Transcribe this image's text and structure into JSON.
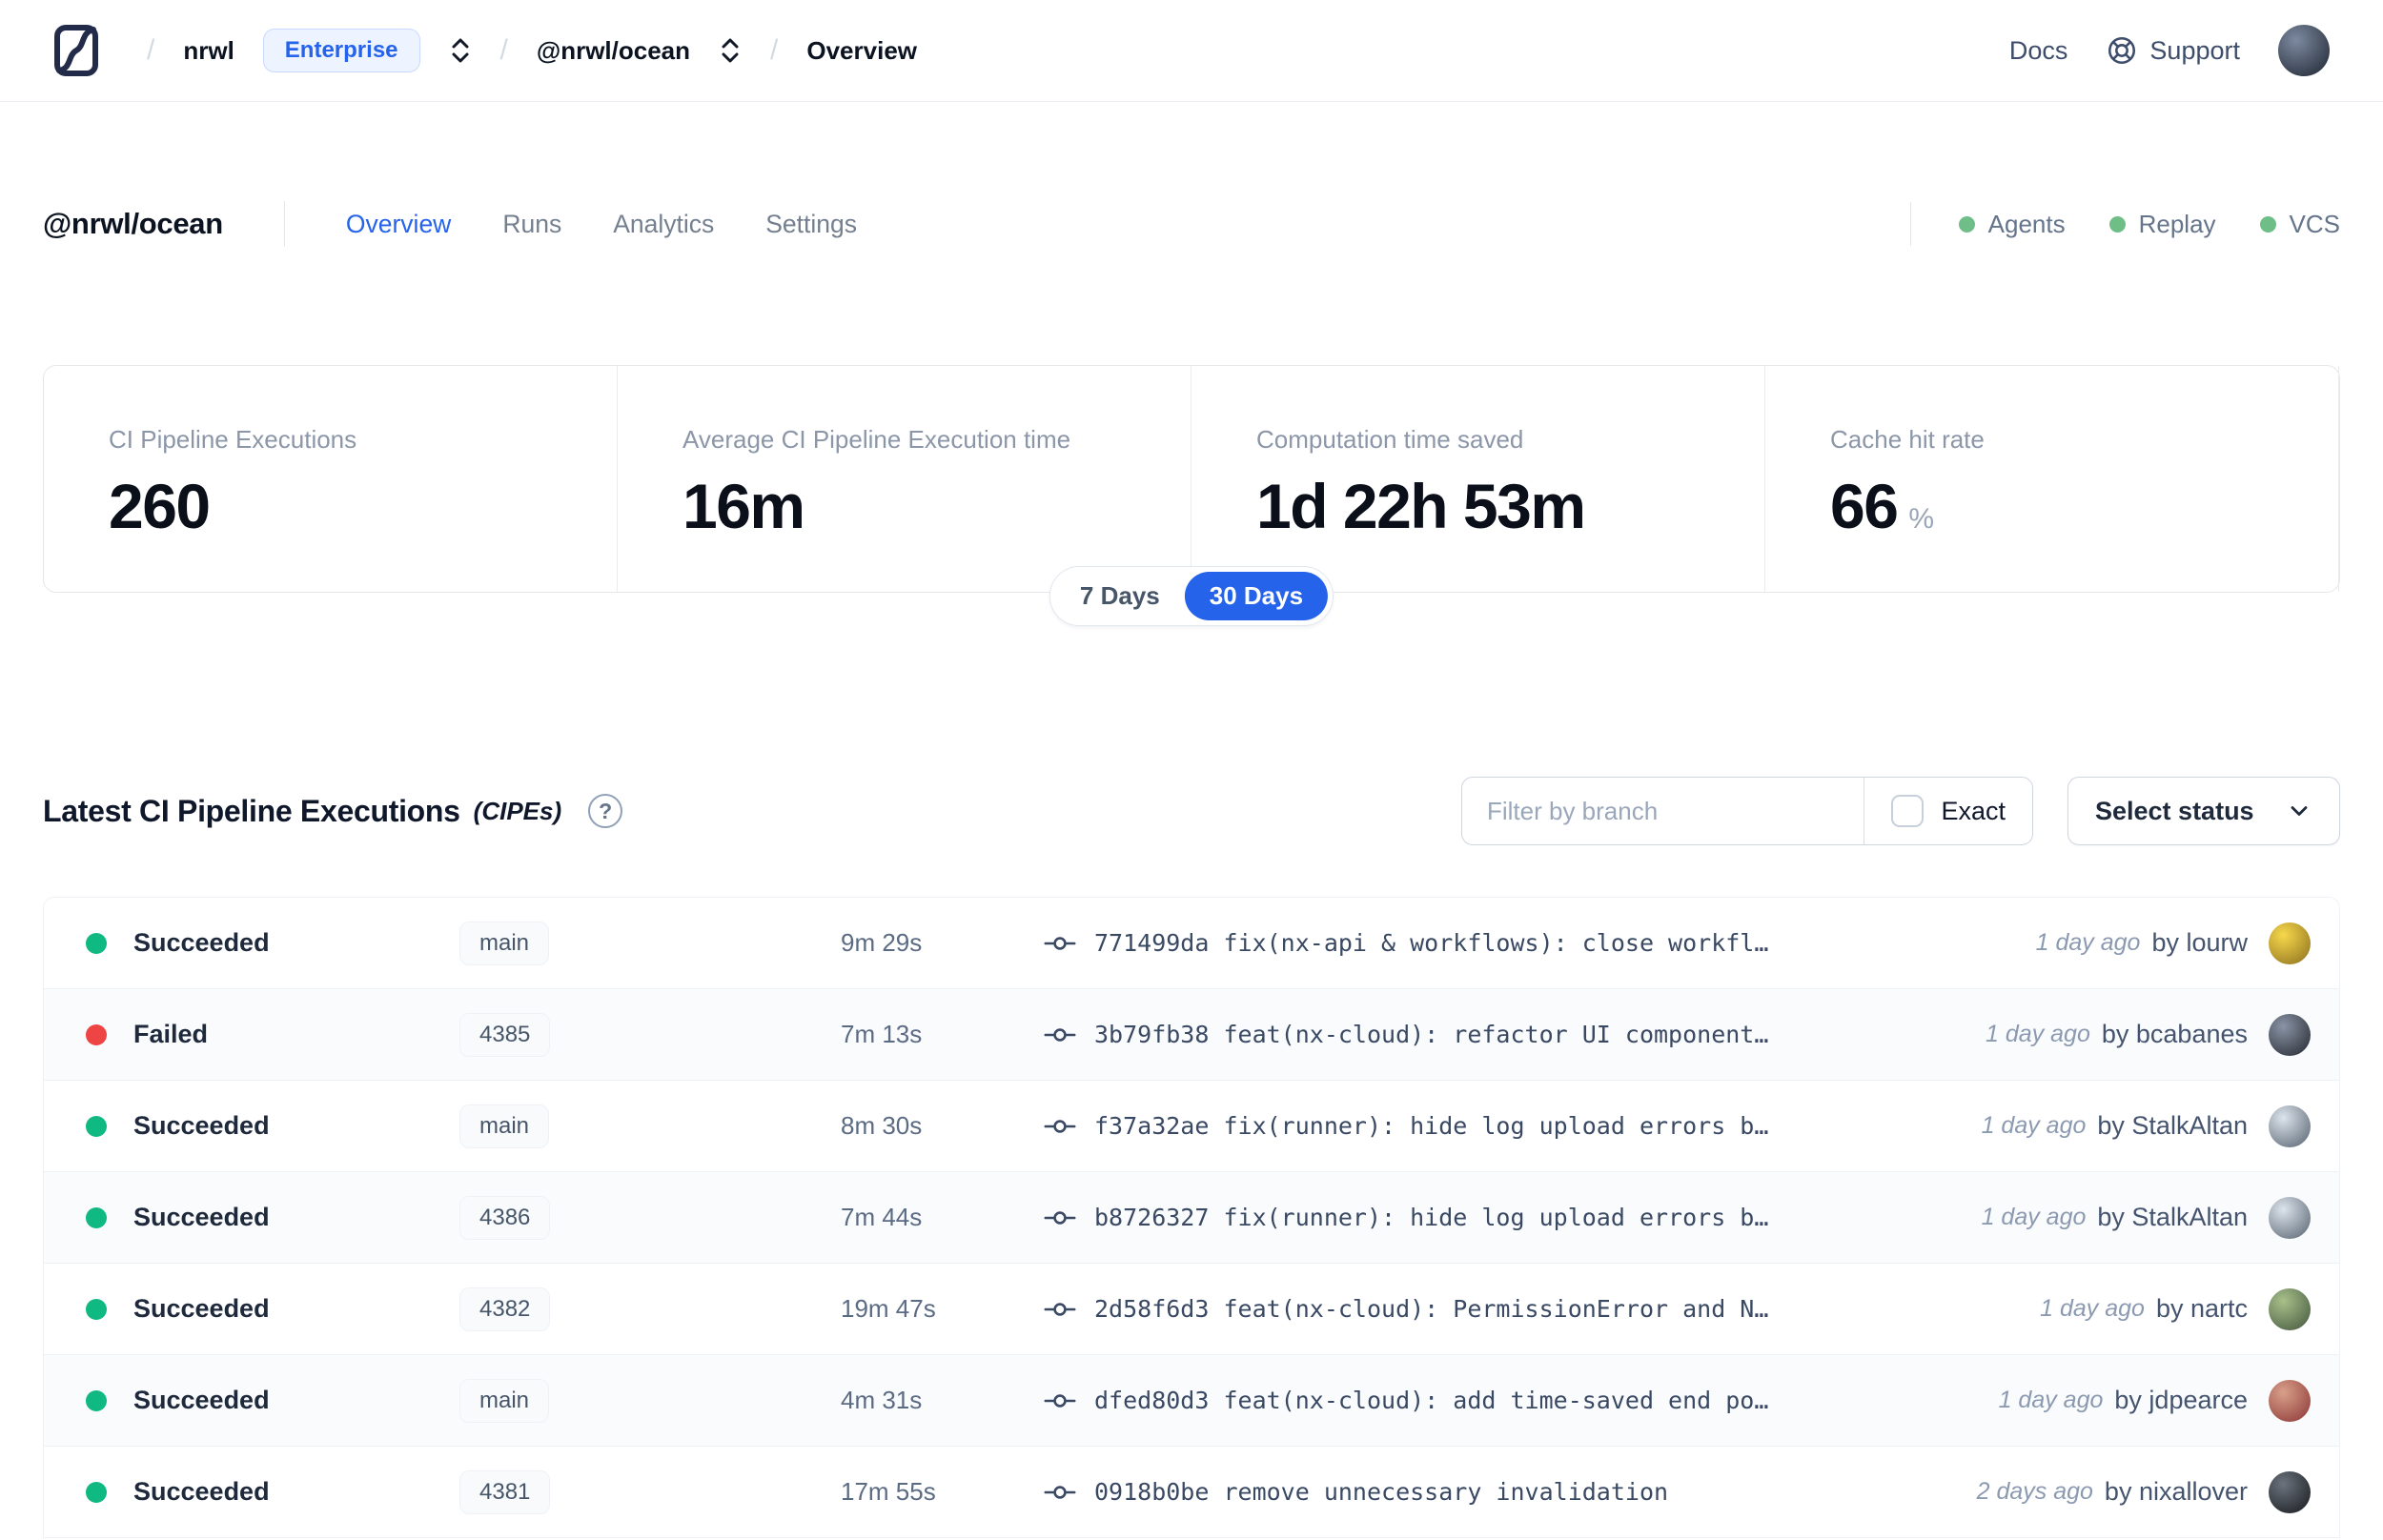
{
  "colors": {
    "accent": "#2563eb",
    "success": "#10b981",
    "failed": "#ef4444",
    "indicator": "#6fbe88"
  },
  "icons": {
    "help": "?",
    "slash": "/"
  },
  "header": {
    "breadcrumb": {
      "org": "nrwl",
      "org_badge": "Enterprise",
      "workspace": "@nrwl/ocean",
      "page": "Overview"
    },
    "docs": "Docs",
    "support": "Support"
  },
  "workspace": {
    "title": "@nrwl/ocean",
    "tabs": [
      {
        "label": "Overview"
      },
      {
        "label": "Runs"
      },
      {
        "label": "Analytics"
      },
      {
        "label": "Settings"
      }
    ],
    "active_tab": "Overview",
    "indicators": [
      {
        "label": "Agents"
      },
      {
        "label": "Replay"
      },
      {
        "label": "VCS"
      }
    ]
  },
  "stats": [
    {
      "label": "CI Pipeline Executions",
      "value": "260",
      "suffix": ""
    },
    {
      "label": "Average CI Pipeline Execution time",
      "value": "16m",
      "suffix": ""
    },
    {
      "label": "Computation time saved",
      "value": "1d 22h 53m",
      "suffix": ""
    },
    {
      "label": "Cache hit rate",
      "value": "66",
      "suffix": "%"
    }
  ],
  "time_toggle": {
    "inactive": "7 Days",
    "active": "30 Days"
  },
  "cipes": {
    "title": "Latest CI Pipeline Executions",
    "title_note": "(CIPEs)",
    "filter_placeholder": "Filter by branch",
    "exact_label": "Exact",
    "status_select_label": "Select status",
    "rows": [
      {
        "status": "Succeeded",
        "ok": true,
        "branch": "main",
        "duration": "9m 29s",
        "commit": "771499da fix(nx-api & workflows): close workfl…",
        "time_ago": "1 day ago",
        "author": "by lourw",
        "avatar": "#f7d84b,#8a6d1f"
      },
      {
        "status": "Failed",
        "ok": false,
        "branch": "4385",
        "duration": "7m 13s",
        "commit": "3b79fb38 feat(nx-cloud): refactor UI component…",
        "time_ago": "1 day ago",
        "author": "by bcabanes",
        "avatar": "#8a94a6,#23272e"
      },
      {
        "status": "Succeeded",
        "ok": true,
        "branch": "main",
        "duration": "8m 30s",
        "commit": "f37a32ae fix(runner): hide log upload errors b…",
        "time_ago": "1 day ago",
        "author": "by StalkAltan",
        "avatar": "#dce4ec,#55616e"
      },
      {
        "status": "Succeeded",
        "ok": true,
        "branch": "4386",
        "duration": "7m 44s",
        "commit": "b8726327 fix(runner): hide log upload errors b…",
        "time_ago": "1 day ago",
        "author": "by StalkAltan",
        "avatar": "#dce4ec,#55616e"
      },
      {
        "status": "Succeeded",
        "ok": true,
        "branch": "4382",
        "duration": "19m 47s",
        "commit": "2d58f6d3 feat(nx-cloud): PermissionError and N…",
        "time_ago": "1 day ago",
        "author": "by nartc",
        "avatar": "#a8c08a,#42553d"
      },
      {
        "status": "Succeeded",
        "ok": true,
        "branch": "main",
        "duration": "4m 31s",
        "commit": "dfed80d3 feat(nx-cloud): add time-saved end po…",
        "time_ago": "1 day ago",
        "author": "by jdpearce",
        "avatar": "#d9a08a,#8a3434"
      },
      {
        "status": "Succeeded",
        "ok": true,
        "branch": "4381",
        "duration": "17m 55s",
        "commit": "0918b0be remove unnecessary invalidation",
        "time_ago": "2 days ago",
        "author": "by nixallover",
        "avatar": "#6b737d,#17191d"
      }
    ]
  }
}
